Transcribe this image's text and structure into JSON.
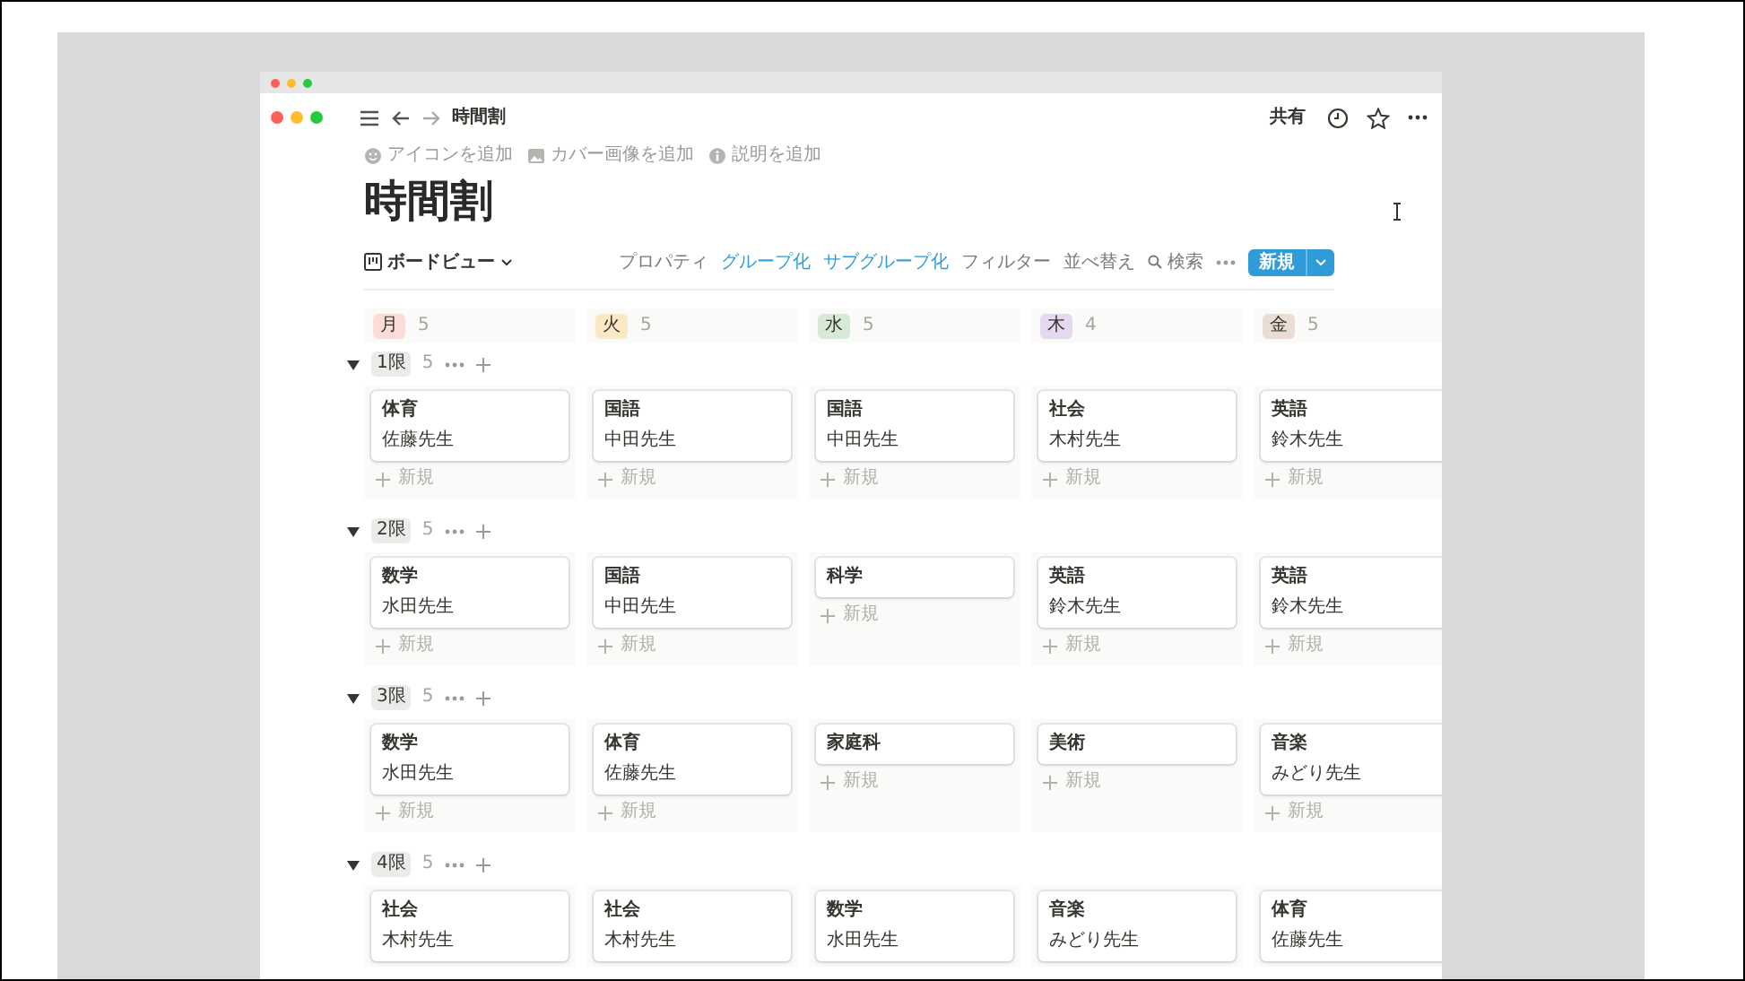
{
  "window": {
    "title": "時間割"
  },
  "header_actions": {
    "share": "共有"
  },
  "page_actions": [
    "アイコンを追加",
    "カバー画像を追加",
    "説明を追加"
  ],
  "page_title": "時間割",
  "view": {
    "label": "ボードビュー"
  },
  "toolbar": {
    "items": [
      {
        "label": "プロパティ",
        "active": false
      },
      {
        "label": "グループ化",
        "active": true
      },
      {
        "label": "サブグループ化",
        "active": true
      },
      {
        "label": "フィルター",
        "active": false
      },
      {
        "label": "並べ替え",
        "active": false
      },
      {
        "label": "検索",
        "active": false,
        "kind": "search"
      }
    ],
    "new_button": "新規"
  },
  "columns": [
    {
      "label": "月",
      "count": "5",
      "color": "#fbdcd7"
    },
    {
      "label": "火",
      "count": "5",
      "color": "#fbe9c6"
    },
    {
      "label": "水",
      "count": "5",
      "color": "#d6ead7"
    },
    {
      "label": "木",
      "count": "4",
      "color": "#e4d9ee"
    },
    {
      "label": "金",
      "count": "5",
      "color": "#ecdcd6"
    }
  ],
  "groups": [
    {
      "label": "1限",
      "count": "5",
      "expanded": true,
      "cells": [
        {
          "cards": [
            {
              "title": "体育",
              "teacher": "佐藤先生"
            }
          ],
          "new_label": "新規"
        },
        {
          "cards": [
            {
              "title": "国語",
              "teacher": "中田先生"
            }
          ],
          "new_label": "新規"
        },
        {
          "cards": [
            {
              "title": "国語",
              "teacher": "中田先生"
            }
          ],
          "new_label": "新規"
        },
        {
          "cards": [
            {
              "title": "社会",
              "teacher": "木村先生"
            }
          ],
          "new_label": "新規"
        },
        {
          "cards": [
            {
              "title": "英語",
              "teacher": "鈴木先生"
            }
          ],
          "new_label": "新規"
        }
      ]
    },
    {
      "label": "2限",
      "count": "5",
      "expanded": true,
      "cells": [
        {
          "cards": [
            {
              "title": "数学",
              "teacher": "水田先生"
            }
          ],
          "new_label": "新規"
        },
        {
          "cards": [
            {
              "title": "国語",
              "teacher": "中田先生"
            }
          ],
          "new_label": "新規"
        },
        {
          "cards": [
            {
              "title": "科学"
            }
          ],
          "new_label": "新規"
        },
        {
          "cards": [
            {
              "title": "英語",
              "teacher": "鈴木先生"
            }
          ],
          "new_label": "新規"
        },
        {
          "cards": [
            {
              "title": "英語",
              "teacher": "鈴木先生"
            }
          ],
          "new_label": "新規"
        }
      ]
    },
    {
      "label": "3限",
      "count": "5",
      "expanded": true,
      "cells": [
        {
          "cards": [
            {
              "title": "数学",
              "teacher": "水田先生"
            }
          ],
          "new_label": "新規"
        },
        {
          "cards": [
            {
              "title": "体育",
              "teacher": "佐藤先生"
            }
          ],
          "new_label": "新規"
        },
        {
          "cards": [
            {
              "title": "家庭科"
            }
          ],
          "new_label": "新規"
        },
        {
          "cards": [
            {
              "title": "美術"
            }
          ],
          "new_label": "新規"
        },
        {
          "cards": [
            {
              "title": "音楽",
              "teacher": "みどり先生"
            }
          ],
          "new_label": "新規"
        }
      ]
    },
    {
      "label": "4限",
      "count": "5",
      "expanded": true,
      "cells": [
        {
          "cards": [
            {
              "title": "社会",
              "teacher": "木村先生"
            }
          ]
        },
        {
          "cards": [
            {
              "title": "社会",
              "teacher": "木村先生"
            }
          ]
        },
        {
          "cards": [
            {
              "title": "数学",
              "teacher": "水田先生"
            }
          ]
        },
        {
          "cards": [
            {
              "title": "音楽",
              "teacher": "みどり先生"
            }
          ]
        },
        {
          "cards": [
            {
              "title": "体育",
              "teacher": "佐藤先生"
            }
          ]
        }
      ]
    }
  ]
}
